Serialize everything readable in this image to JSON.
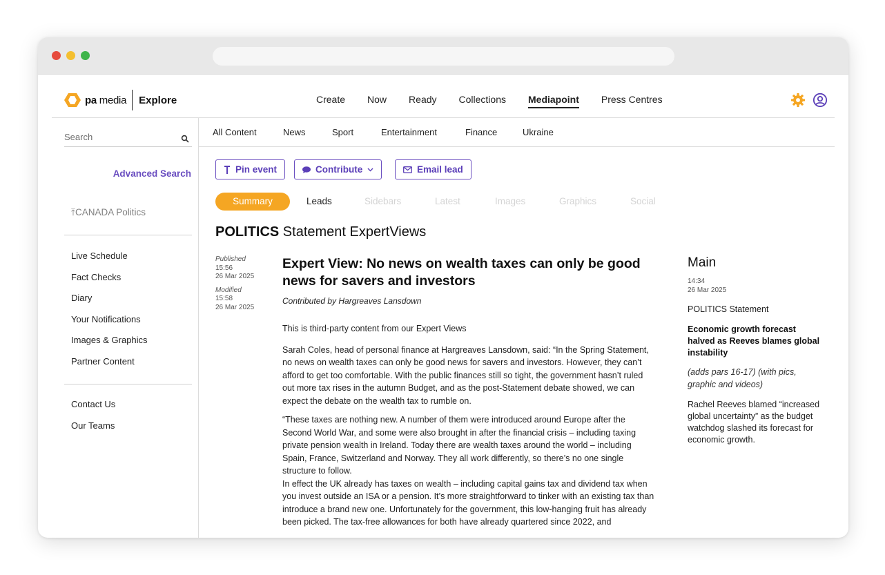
{
  "brand": {
    "logo_text": "pa",
    "logo_text_light": " media",
    "product": "Explore",
    "accent": "#6a4ec0",
    "highlight": "#f5a623",
    "logo_color": "#f5a623"
  },
  "main_nav": [
    "Create",
    "Now",
    "Ready",
    "Collections",
    "Mediapoint",
    "Press Centres"
  ],
  "main_nav_active": "Mediapoint",
  "sidebar": {
    "search_placeholder": "Search",
    "advanced_search": "Advanced Search",
    "pinned": "CANADA Politics",
    "items": [
      "Live Schedule",
      "Fact Checks",
      "Diary",
      "Your Notifications",
      "Images & Graphics",
      "Partner Content"
    ],
    "footer_items": [
      "Contact Us",
      "Our Teams"
    ]
  },
  "categories": [
    "All Content",
    "News",
    "Sport",
    "Entertainment",
    "Finance",
    "Ukraine"
  ],
  "actions": {
    "pin_event": "Pin event",
    "contribute": "Contribute",
    "email_lead": "Email lead"
  },
  "tabs": [
    "Summary",
    "Leads",
    "Sidebars",
    "Latest",
    "Images",
    "Graphics",
    "Social"
  ],
  "section": {
    "category": "POLITICS",
    "title": "Statement ExpertViews"
  },
  "meta": {
    "published_label": "Published",
    "published_time": "15:56",
    "published_date": "26 Mar 2025",
    "modified_label": "Modified",
    "modified_time": "15:58",
    "modified_date": "26 Mar 2025"
  },
  "article": {
    "headline": "Expert View: No news on wealth taxes can only be good news for savers and investors",
    "byline": "Contributed by Hargreaves Lansdown",
    "paragraphs": [
      "This is third-party content from our Expert Views",
      "Sarah Coles, head of personal finance at Hargreaves Lansdown, said: “In the Spring Statement, no news on wealth taxes can only be good news for savers and investors. However, they can’t afford to get too comfortable. With the public finances still so tight, the government hasn’t ruled out more tax rises in the autumn Budget, and as the post-Statement debate showed, we can expect the debate on the wealth tax to rumble on.",
      "“These taxes are nothing new. A number of them were introduced around Europe after the Second World War, and some were also brought in after the financial crisis – including taxing private pension wealth in Ireland. Today there are wealth taxes around the world – including Spain, France, Switzerland and Norway. They all work differently, so there’s no one single structure to follow.",
      "In effect the UK already has taxes on wealth – including capital gains tax and dividend tax when you invest outside an ISA or a pension. It’s more straightforward to tinker with an existing tax than introduce a brand new one. Unfortunately for the government, this low-hanging fruit has already been picked. The tax-free allowances for both have already quartered since 2022, and"
    ]
  },
  "rail": {
    "title": "Main",
    "time": "14:34",
    "date": "26 Mar 2025",
    "category": "POLITICS",
    "category_sub": "Statement",
    "headline": "Economic growth forecast halved as Reeves blames global instability",
    "note": "(adds pars 16-17) (with pics, graphic and videos)",
    "text": "Rachel Reeves blamed “increased global uncertainty” as the budget watchdog slashed its forecast for economic growth."
  }
}
